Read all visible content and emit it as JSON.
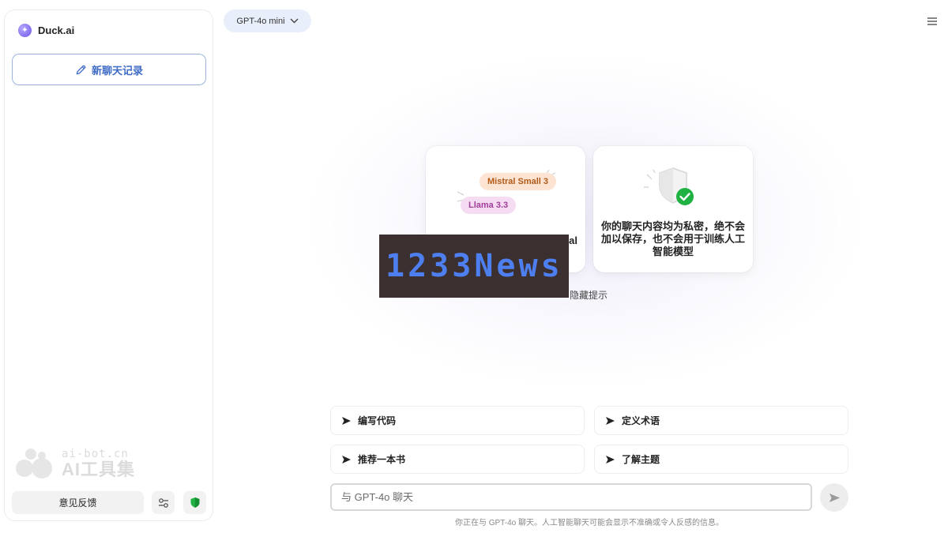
{
  "sidebar": {
    "brand": "Duck.ai",
    "new_chat_label": "新聊天记录",
    "feedback_label": "意见反馈",
    "watermark": {
      "top": "ai-bot.cn",
      "bottom": "AI工具集"
    }
  },
  "header": {
    "model_label": "GPT-4o mini"
  },
  "cards": {
    "models": [
      "Mistral Small 3",
      "Llama 3.3"
    ],
    "left_text_partial": "al",
    "privacy_text": "你的聊天内容均为私密，绝不会加以保存，也不会用于训练人工智能模型",
    "hide_tips_label": "隐藏提示"
  },
  "banner": {
    "text": "1233News"
  },
  "suggestions": [
    "编写代码",
    "定义术语",
    "推荐一本书",
    "了解主题"
  ],
  "chat": {
    "placeholder": "与 GPT-4o 聊天",
    "disclaimer": "你正在与 GPT-4o 聊天。人工智能聊天可能会显示不准确或令人反感的信息。"
  },
  "colors": {
    "accent": "#3f6cc7",
    "shield_green": "#1fb141",
    "model_chip_bg": "#e9eefb"
  }
}
